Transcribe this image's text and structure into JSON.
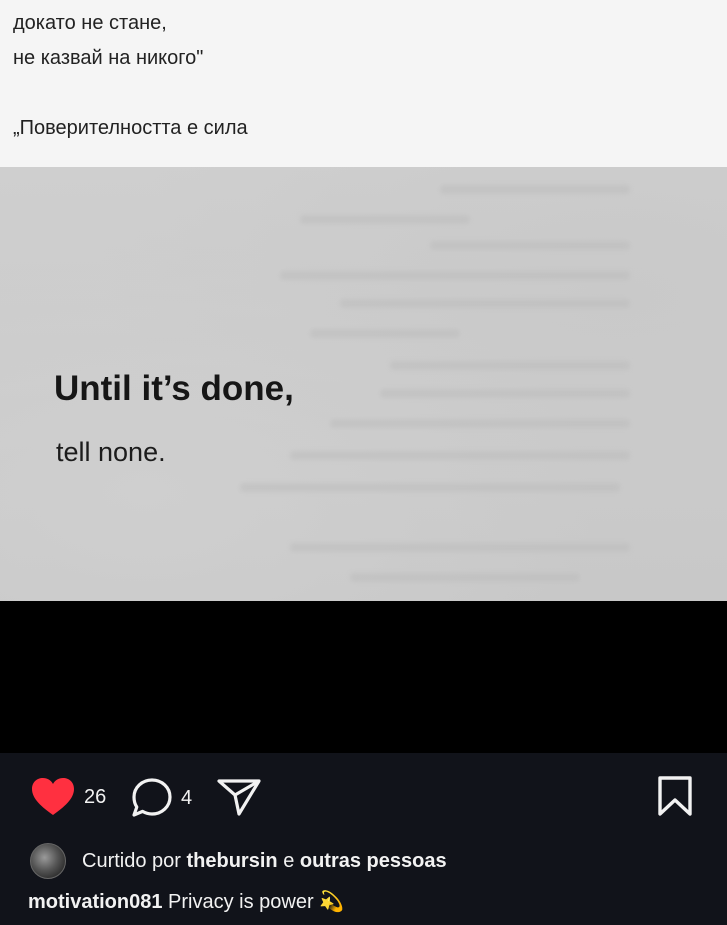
{
  "post_text": {
    "line1": "докато не стане,",
    "line2": "не казвай на никого\"",
    "line3": "„Поверителността е сила"
  },
  "image": {
    "quote_line1": "Until it’s done,",
    "quote_line2": "tell none."
  },
  "actions": {
    "like_count": "26",
    "comment_count": "4"
  },
  "likes": {
    "prefix": "Curtido por",
    "user": "thebursin",
    "connector": "e",
    "others": "outras pessoas"
  },
  "caption": {
    "username": "motivation081",
    "text": "Privacy is power",
    "emoji": "💫"
  },
  "colors": {
    "like_red": "#ff3040",
    "footer_bg": "#11131a"
  }
}
